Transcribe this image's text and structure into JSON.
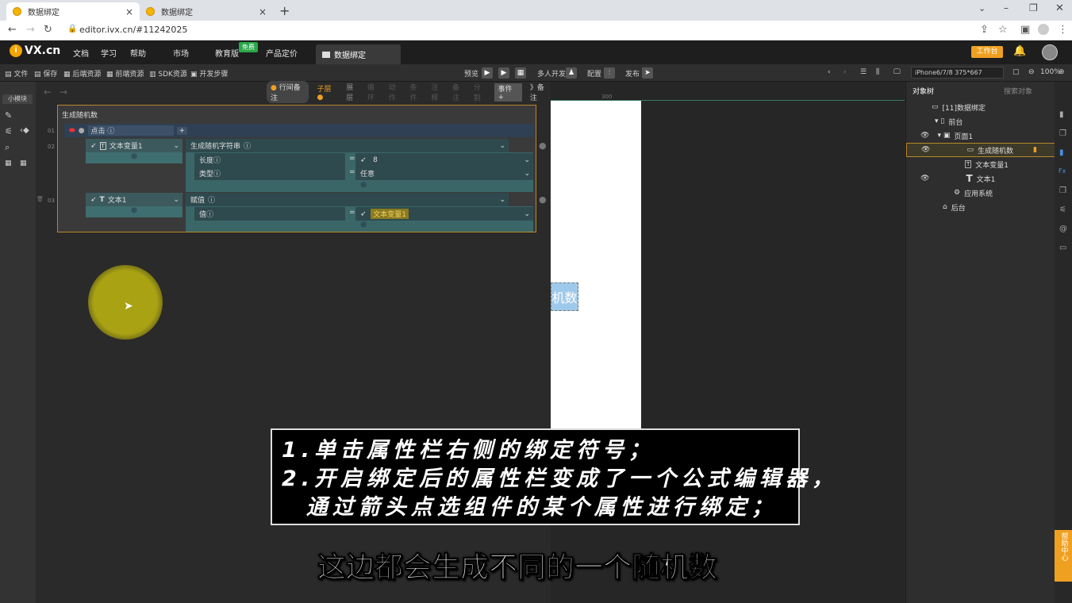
{
  "browser": {
    "tabs": [
      {
        "title": "数据绑定"
      },
      {
        "title": "数据绑定"
      }
    ],
    "new_tab": "+",
    "url": "editor.ivx.cn/#11242025"
  },
  "header": {
    "logo": "VX.cn",
    "menus": [
      "文档",
      "学习",
      "帮助",
      "市场",
      "教育版",
      "产品定价"
    ],
    "free_badge": "免费",
    "current_tab": "数据绑定",
    "work_button": "工作台"
  },
  "toolbar": {
    "left": [
      "文件",
      "保存",
      "后端资源",
      "前端资源",
      "SDK资源",
      "开发步骤"
    ],
    "preview": "预览",
    "multi_dev": "多人开发",
    "config": "配置",
    "publish": "发布",
    "device": "iPhone6/7/8 375*667",
    "zoom": "100%"
  },
  "leftstrip": {
    "label": "小模块"
  },
  "logic": {
    "bar_items": [
      "行间备注",
      "子层",
      "展层",
      "循环",
      "动作",
      "条件",
      "注释",
      "备注",
      "分割",
      "事件"
    ],
    "bar_right": "》备注",
    "block_title": "生成随机数",
    "event": "点击",
    "row_numbers": [
      "01",
      "02",
      "03"
    ],
    "target1": "文本变量1",
    "action1": "生成随机字符串",
    "params1": [
      {
        "name": "长度",
        "value": "8"
      },
      {
        "name": "类型",
        "value": "任意"
      }
    ],
    "target2": "文本1",
    "action2": "赋值",
    "params2": [
      {
        "name": "值",
        "value": "文本变量1"
      }
    ]
  },
  "canvas": {
    "button_text": "机数",
    "ruler": "300"
  },
  "rpanel": {
    "tabs": [
      "对象树",
      "搜索对象"
    ],
    "tree": [
      {
        "label": "[11]数据绑定",
        "indent": 0
      },
      {
        "label": "前台",
        "indent": 1
      },
      {
        "label": "页面1",
        "indent": 2
      },
      {
        "label": "生成随机数",
        "indent": 3
      },
      {
        "label": "文本变量1",
        "indent": 3
      },
      {
        "label": "文本1",
        "indent": 3
      },
      {
        "label": "应用系统",
        "indent": 2
      },
      {
        "label": "后台",
        "indent": 1
      }
    ]
  },
  "help": "帮助中心",
  "subtitle": {
    "lines": [
      "1.单击属性栏右侧的绑定符号；",
      "2.开启绑定后的属性栏变成了一个公式编辑器，",
      "  通过箭头点选组件的某个属性进行绑定；"
    ],
    "caption": "这边都会生成不同的一个随机数"
  }
}
